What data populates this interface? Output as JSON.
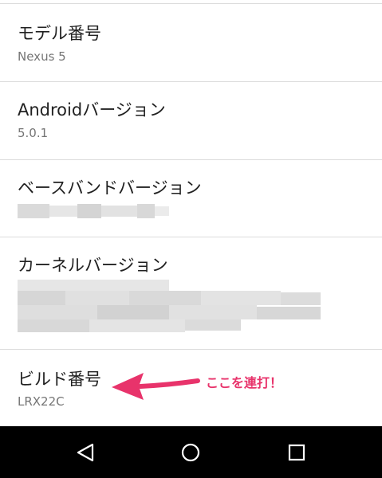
{
  "settings": {
    "items": [
      {
        "title": "モデル番号",
        "summary": "Nexus 5"
      },
      {
        "title": "Androidバージョン",
        "summary": "5.0.1"
      },
      {
        "title": "ベースバンドバージョン",
        "summary": ""
      },
      {
        "title": "カーネルバージョン",
        "summary": ""
      },
      {
        "title": "ビルド番号",
        "summary": "LRX22C"
      }
    ]
  },
  "annotation": {
    "text": "ここを連打！",
    "color": "#e8336b"
  },
  "navbar": {
    "buttons": [
      {
        "name": "back",
        "icon": "back-triangle-icon"
      },
      {
        "name": "home",
        "icon": "home-circle-icon"
      },
      {
        "name": "recents",
        "icon": "recents-square-icon"
      }
    ]
  }
}
